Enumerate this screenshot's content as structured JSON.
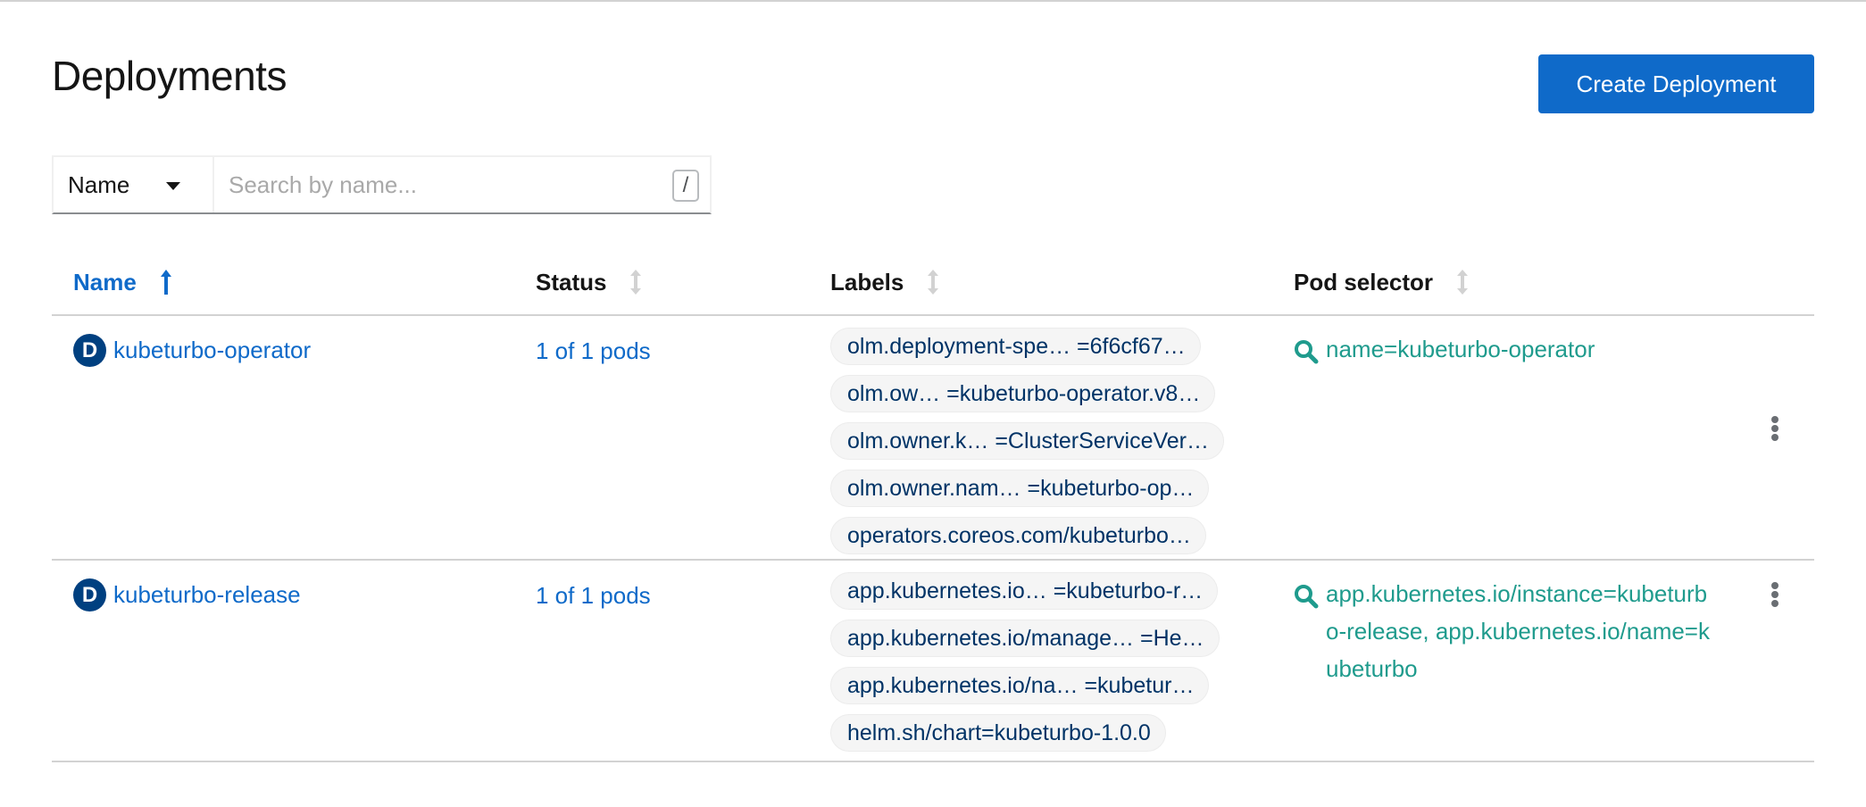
{
  "page": {
    "title": "Deployments",
    "create_button_label": "Create Deployment"
  },
  "toolbar": {
    "filter_selected": "Name",
    "search_placeholder": "Search by name...",
    "search_value": "",
    "keyboard_hint": "/"
  },
  "table": {
    "columns": [
      {
        "label": "Name",
        "sort": "ascending",
        "active": true
      },
      {
        "label": "Status",
        "sort": "none",
        "active": false
      },
      {
        "label": "Labels",
        "sort": "none",
        "active": false
      },
      {
        "label": "Pod selector",
        "sort": "none",
        "active": false
      }
    ],
    "rows": [
      {
        "badge": "D",
        "name": "kubeturbo-operator",
        "status": "1 of 1 pods",
        "labels": [
          "olm.deployment-spe…  =6f6cf67…",
          "olm.ow…  =kubeturbo-operator.v8…",
          "olm.owner.k… =ClusterServiceVer…",
          "olm.owner.nam…  =kubeturbo-op…",
          "operators.coreos.com/kubeturbo…"
        ],
        "pod_selector": "name=kubeturbo-operator"
      },
      {
        "badge": "D",
        "name": "kubeturbo-release",
        "status": "1 of 1 pods",
        "labels": [
          "app.kubernetes.io…  =kubeturbo-r…",
          "app.kubernetes.io/manage… =He…",
          "app.kubernetes.io/na…  =kubetur…",
          "helm.sh/chart=kubeturbo-1.0.0"
        ],
        "pod_selector": "app.kubernetes.io/instance=kubeturbo-release, app.kubernetes.io/name=kubeturbo"
      }
    ]
  },
  "colors": {
    "primary": "#0f6ac9",
    "badge": "#004080",
    "selector": "#1f9b8d",
    "label_text": "#003366"
  }
}
